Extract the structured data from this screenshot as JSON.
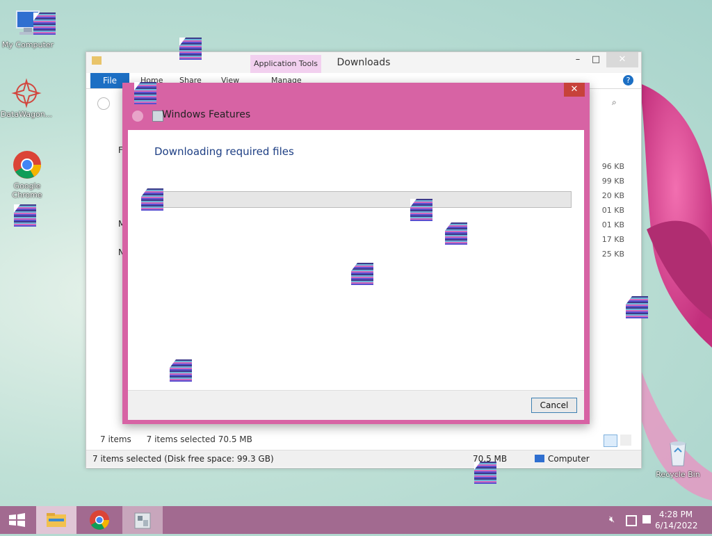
{
  "desktop": {
    "icons": [
      {
        "label": "My Computer",
        "icon": "my-computer-icon"
      },
      {
        "label": "DataWagon...",
        "icon": "datawagon-icon"
      },
      {
        "label": "Google Chrome",
        "icon": "chrome-icon"
      },
      {
        "label": "Recycle Bin",
        "icon": "recycle-bin-icon"
      }
    ],
    "background_colors": {
      "sky": "#b5dbd2",
      "petal": "#e43f96"
    }
  },
  "explorer": {
    "title": "Downloads",
    "context_tab": "Application Tools",
    "ribbon_tabs": [
      "File",
      "Home",
      "Share",
      "View",
      "Manage"
    ],
    "nav_partial": [
      "F",
      "M",
      "N"
    ],
    "file_sizes": [
      "96 KB",
      "99 KB",
      "20 KB",
      "01 KB",
      "01 KB",
      "17 KB",
      "25 KB"
    ],
    "item_count": "7 items",
    "selected": "7 items selected  70.5 MB",
    "statusbar": {
      "left": "7 items selected (Disk free space: 99.3 GB)",
      "size": "70.5 MB",
      "location": "Computer"
    },
    "accent": "#1c6fc4"
  },
  "dialog": {
    "title": "Windows Features",
    "heading": "Downloading required files",
    "progress_fraction": 0.0,
    "cancel_label": "Cancel",
    "frame_color": "#d763a4"
  },
  "taskbar": {
    "time": "4:28 PM",
    "date": "6/14/2022",
    "apps": [
      "file-explorer-icon",
      "chrome-icon",
      "windows-features-icon"
    ],
    "tray": [
      "volume-muted-icon",
      "network-icon",
      "action-center-icon"
    ]
  }
}
